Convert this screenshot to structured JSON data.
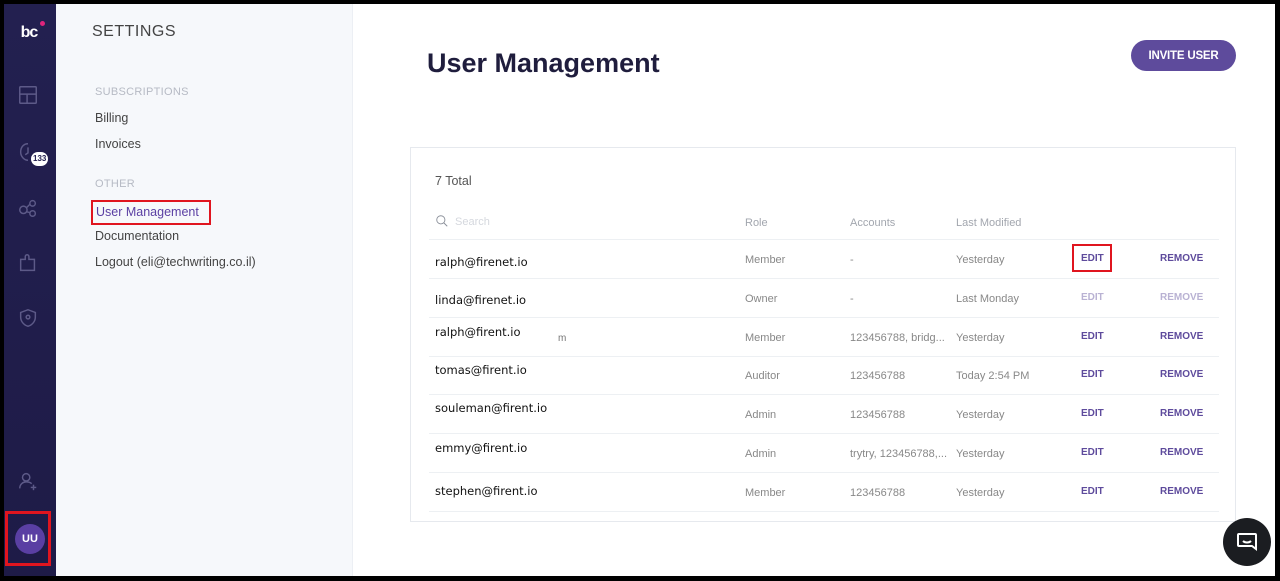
{
  "rail": {
    "logo_text": "bc",
    "badge_count": "133",
    "avatar_initials": "UU",
    "icons": [
      "dashboard-icon",
      "alerts-icon",
      "integrations-icon",
      "plugins-icon",
      "shield-icon",
      "add-user-icon"
    ]
  },
  "settings": {
    "title": "SETTINGS",
    "sections": [
      {
        "heading": "SUBSCRIPTIONS",
        "links": [
          "Billing",
          "Invoices"
        ]
      },
      {
        "heading": "OTHER",
        "links": [
          "User Management",
          "Documentation",
          "Logout (eli@techwriting.co.il)"
        ]
      }
    ],
    "active_link": "User Management"
  },
  "main": {
    "title": "User Management",
    "invite_label": "INVITE USER",
    "total_label": "7 Total",
    "search_placeholder": "Search",
    "columns": [
      "Role",
      "Accounts",
      "Last Modified"
    ],
    "rows": [
      {
        "email": "ralph@firenet.io",
        "suffix": "",
        "role": "Member",
        "accounts": "-",
        "modified": "Yesterday",
        "edit": "EDIT",
        "remove": "REMOVE",
        "disabled": false
      },
      {
        "email": "linda@firenet.io",
        "suffix": "",
        "role": "Owner",
        "accounts": "-",
        "modified": "Last Monday",
        "edit": "EDIT",
        "remove": "REMOVE",
        "disabled": true
      },
      {
        "email": "ralph@firent.io",
        "suffix": "m",
        "role": "Member",
        "accounts": "123456788, bridg...",
        "modified": "Yesterday",
        "edit": "EDIT",
        "remove": "REMOVE",
        "disabled": false
      },
      {
        "email": "tomas@firent.io",
        "suffix": "",
        "role": "Auditor",
        "accounts": "123456788",
        "modified": "Today 2:54 PM",
        "edit": "EDIT",
        "remove": "REMOVE",
        "disabled": false
      },
      {
        "email": "souleman@firent.io",
        "suffix": "",
        "role": "Admin",
        "accounts": "123456788",
        "modified": "Yesterday",
        "edit": "EDIT",
        "remove": "REMOVE",
        "disabled": false
      },
      {
        "email": "emmy@firent.io",
        "suffix": "",
        "role": "Admin",
        "accounts": "trytry, 123456788,...",
        "modified": "Yesterday",
        "edit": "EDIT",
        "remove": "REMOVE",
        "disabled": false
      },
      {
        "email": "stephen@firent.io",
        "suffix": "",
        "role": "Member",
        "accounts": "123456788",
        "modified": "Yesterday",
        "edit": "EDIT",
        "remove": "REMOVE",
        "disabled": false
      }
    ]
  },
  "colors": {
    "accent": "#5e4b9c",
    "rail": "#232050",
    "highlight": "#e0151f"
  }
}
